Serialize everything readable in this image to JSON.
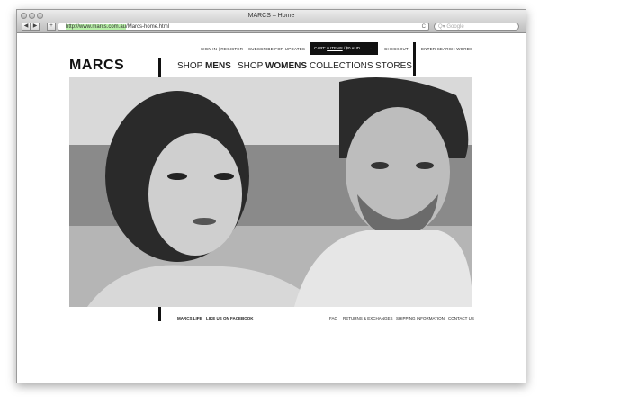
{
  "window": {
    "title": "MARCS – Home",
    "url_highlight": "http://www.marcs.com.au",
    "url_rest": "/Marcs-home.html",
    "search_placeholder": "Google",
    "back_glyph": "◀",
    "forward_glyph": "▶",
    "add_glyph": "+",
    "reload_glyph": "C",
    "search_glyph": "Q▾"
  },
  "header": {
    "sign_in": "SIGN IN | REGISTER",
    "subscribe": "SUBSCRIBE FOR UPDATES",
    "cart_prefix": "CART:",
    "cart_items": "0 ITEMS",
    "cart_total": "/ $0 AUD",
    "cart_chevron": "⌄",
    "checkout": "CHECKOUT",
    "search": "ENTER SEARCH WORDS"
  },
  "logo": "MARCS",
  "nav": {
    "mens_prefix": "SHOP ",
    "mens": "MENS",
    "womens_prefix": "SHOP ",
    "womens": "WOMENS",
    "collections": "COLLECTIONS",
    "stores": "STORES"
  },
  "footer": {
    "marcs_life": "MARCS LIFE",
    "facebook": "LIKE US ON FACEBOOK",
    "faq": "FAQ",
    "returns": "RETURNS & EXCHANGES",
    "shipping": "SHIPPING INFORMATION",
    "contact": "CONTACT US"
  }
}
